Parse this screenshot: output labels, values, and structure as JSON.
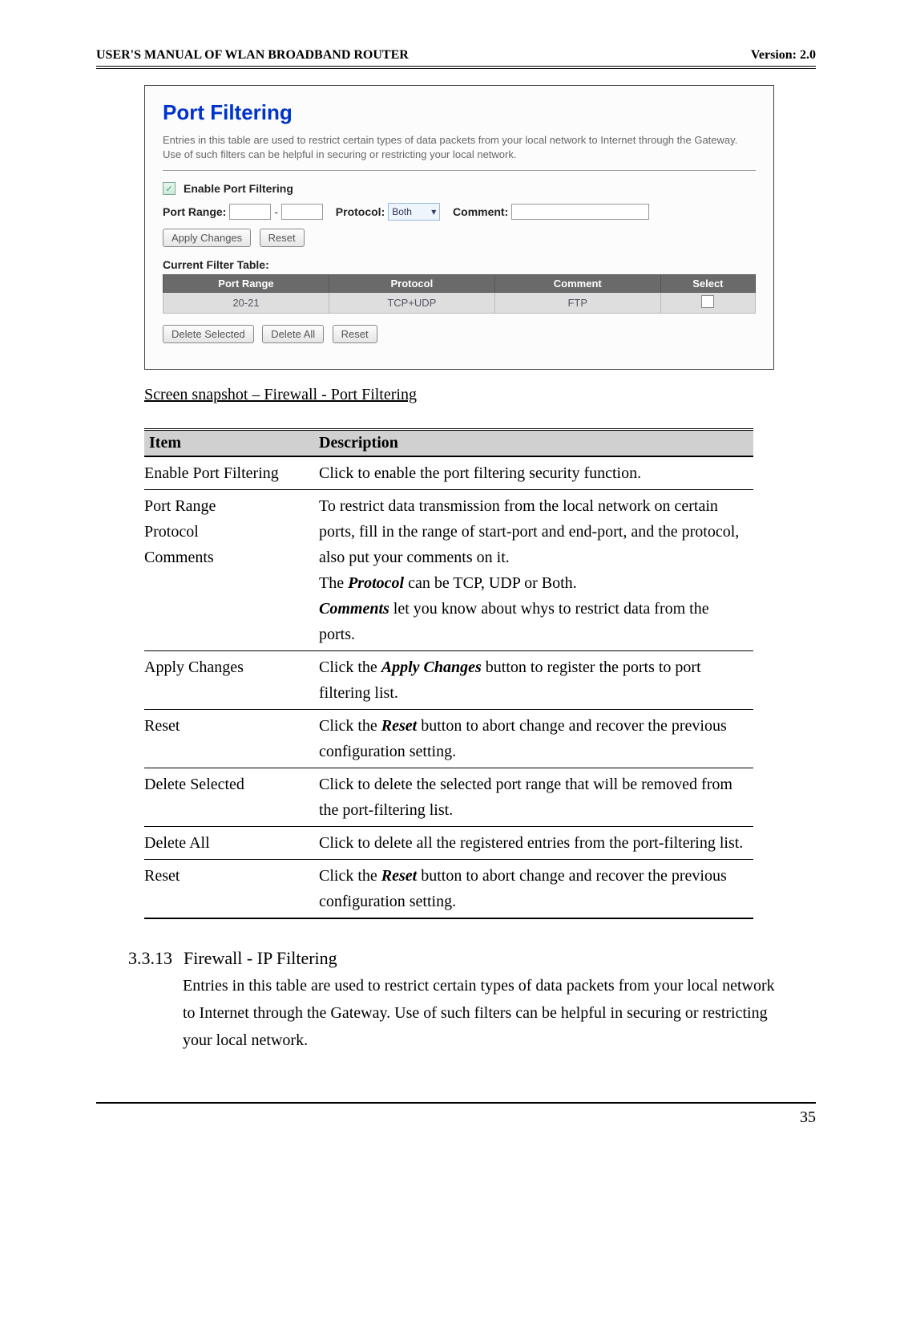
{
  "header": {
    "left": "USER'S MANUAL OF WLAN BROADBAND ROUTER",
    "right": "Version: 2.0"
  },
  "screenshot": {
    "title": "Port Filtering",
    "desc": "Entries in this table are used to restrict certain types of data packets from your local network to Internet through the Gateway. Use of such filters can be helpful in securing or restricting your local network.",
    "enable_label": "Enable Port Filtering",
    "port_range_label": "Port Range:",
    "dash": "-",
    "protocol_label": "Protocol:",
    "protocol_value": "Both",
    "comment_label": "Comment:",
    "btn_apply": "Apply Changes",
    "btn_reset1": "Reset",
    "current_filter_label": "Current Filter Table:",
    "th_port_range": "Port Range",
    "th_protocol": "Protocol",
    "th_comment": "Comment",
    "th_select": "Select",
    "row": {
      "port_range": "20-21",
      "protocol": "TCP+UDP",
      "comment": "FTP"
    },
    "btn_delete_selected": "Delete Selected",
    "btn_delete_all": "Delete All",
    "btn_reset2": "Reset"
  },
  "caption": "Screen snapshot – Firewall - Port Filtering",
  "table": {
    "h_item": "Item",
    "h_desc": "Description",
    "rows": [
      {
        "item": "Enable Port Filtering",
        "desc_plain": "Click to enable the port filtering security function."
      },
      {
        "item_lines": [
          "Port Range",
          "Protocol",
          "Comments"
        ],
        "desc_pre": "To restrict data transmission from the local network on certain ports, fill in the range of start-port and end-port, and the protocol, also put your comments on it.",
        "desc_proto_pre": "The ",
        "desc_proto_bi": "Protocol",
        "desc_proto_post": " can be TCP, UDP or Both.",
        "desc_comm_bi": "Comments",
        "desc_comm_post": " let you know about whys to restrict data from the ports."
      },
      {
        "item": "Apply Changes",
        "desc_pre": "Click the ",
        "desc_bi": "Apply Changes",
        "desc_post": " button to register the ports to port filtering list."
      },
      {
        "item": "Reset",
        "desc_pre": "Click the ",
        "desc_bi": "Reset",
        "desc_post": " button to abort change and recover the previous configuration setting."
      },
      {
        "item": "Delete Selected",
        "desc_plain": "Click to delete the selected port range that will be removed from the port-filtering list."
      },
      {
        "item": "Delete All",
        "desc_plain": "Click to delete all the registered entries from the port-filtering list."
      },
      {
        "item": "Reset",
        "desc_pre": "Click the ",
        "desc_bi": "Reset",
        "desc_post": " button to abort change and recover the previous configuration setting."
      }
    ]
  },
  "section": {
    "num": "3.3.13",
    "title": "Firewall - IP Filtering",
    "body": "Entries in this table are used to restrict certain types of data packets from your local network to Internet through the Gateway. Use of such filters can be helpful in securing or restricting your local network."
  },
  "page_number": "35"
}
